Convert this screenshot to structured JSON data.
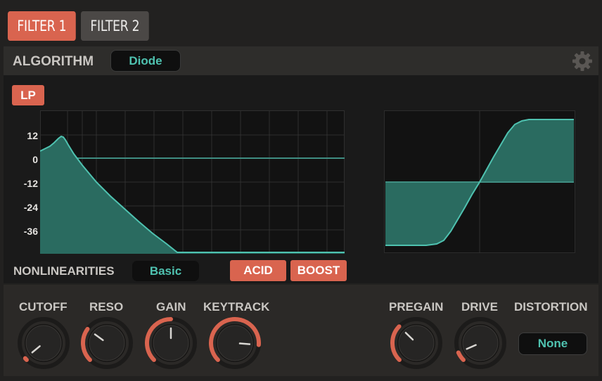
{
  "tabs": [
    {
      "label": "FILTER 1",
      "active": true
    },
    {
      "label": "FILTER 2",
      "active": false
    }
  ],
  "algorithm": {
    "label": "ALGORITHM",
    "value": "Diode"
  },
  "filter_type": "LP",
  "response_graph": {
    "y_ticks": [
      "12",
      "0",
      "-12",
      "-24",
      "-36"
    ]
  },
  "nonlinearities": {
    "label": "NONLINEARITIES",
    "value": "Basic"
  },
  "mode_buttons": {
    "acid": "ACID",
    "boost": "BOOST"
  },
  "knobs": [
    {
      "label": "CUTOFF",
      "value": 0.02
    },
    {
      "label": "RESO",
      "value": 0.3
    },
    {
      "label": "GAIN",
      "value": 0.5
    },
    {
      "label": "KEYTRACK",
      "value": 0.85
    },
    {
      "label": "PREGAIN",
      "value": 0.33
    },
    {
      "label": "DRIVE",
      "value": 0.08
    }
  ],
  "distortion": {
    "label": "DISTORTION",
    "value": "None"
  },
  "colors": {
    "accent": "#d9644f",
    "teal": "#4fc2b0",
    "fill": "#2a6b60"
  }
}
